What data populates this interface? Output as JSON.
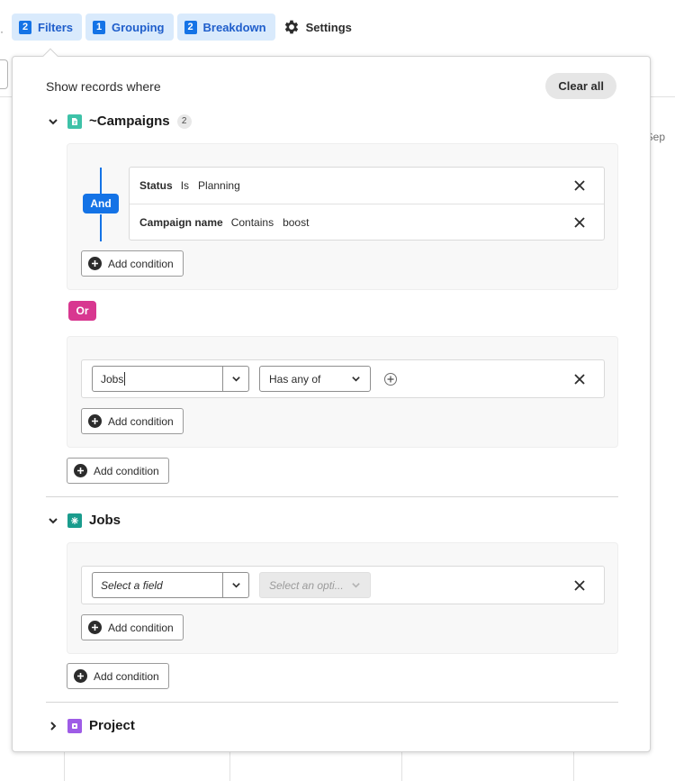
{
  "toolbar": {
    "filters": {
      "count": "2",
      "label": "Filters"
    },
    "grouping": {
      "count": "1",
      "label": "Grouping"
    },
    "breakdown": {
      "count": "2",
      "label": "Breakdown"
    },
    "settings": {
      "label": "Settings",
      "icon": "gear-icon"
    }
  },
  "background": {
    "month_label": "Sep",
    "dot": "·"
  },
  "panel": {
    "title": "Show records where",
    "clear_all": "Clear all",
    "or_label": "Or",
    "add_condition": "Add condition"
  },
  "sections": {
    "campaigns": {
      "title": "~Campaigns",
      "count": "2",
      "icon_color": "#3ec2a8",
      "group1": {
        "operator": "And",
        "conditions": [
          {
            "field": "Status",
            "op": "Is",
            "value": "Planning"
          },
          {
            "field": "Campaign name",
            "op": "Contains",
            "value": "boost"
          }
        ]
      },
      "group2": {
        "field_input": "Jobs",
        "operator_picker": "Has any of"
      }
    },
    "jobs": {
      "title": "Jobs",
      "icon_color": "#1a9c8d",
      "field_placeholder": "Select a field",
      "option_placeholder": "Select an opti..."
    },
    "project": {
      "title": "Project",
      "icon_color": "#9e5ce6"
    }
  },
  "colors": {
    "accent_blue": "#1473e6",
    "or_pink": "#d83790",
    "toolbar_bg": "#d9eafc"
  }
}
